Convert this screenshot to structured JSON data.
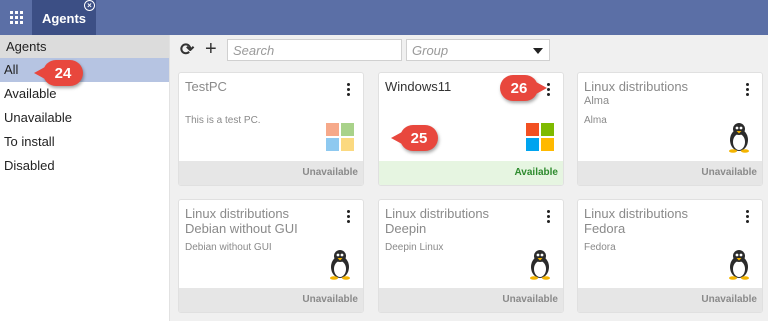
{
  "header": {
    "apps_icon": "grid-icon",
    "tab_label": "Agents",
    "tab_close_icon": "circle-x-icon"
  },
  "sidebar": {
    "title": "Agents",
    "items": [
      {
        "label": "All",
        "active": true
      },
      {
        "label": "Available"
      },
      {
        "label": "Unavailable"
      },
      {
        "label": "To install"
      },
      {
        "label": "Disabled"
      }
    ]
  },
  "toolbar": {
    "refresh_icon": "refresh-icon",
    "add_icon": "plus-icon",
    "search_placeholder": "Search",
    "group_placeholder": "Group"
  },
  "cards": [
    {
      "title": "TestPC",
      "subtitle": "",
      "description": "This is a test PC.",
      "status": "Unavailable",
      "os_icon": "windows-icon"
    },
    {
      "title": "Windows11",
      "subtitle": "",
      "description": "",
      "status": "Available",
      "os_icon": "windows-icon"
    },
    {
      "title": "Linux distributions",
      "subtitle": "Alma",
      "description": "Alma",
      "status": "Unavailable",
      "os_icon": "linux-icon"
    },
    {
      "title": "Linux distributions",
      "subtitle": "Debian without GUI",
      "description": "Debian without GUI",
      "status": "Unavailable",
      "os_icon": "linux-icon"
    },
    {
      "title": "Linux distributions",
      "subtitle": "Deepin",
      "description": "Deepin Linux",
      "status": "Unavailable",
      "os_icon": "linux-icon"
    },
    {
      "title": "Linux distributions",
      "subtitle": "Fedora",
      "description": "Fedora",
      "status": "Unavailable",
      "os_icon": "linux-icon"
    }
  ],
  "callouts": [
    "24",
    "25",
    "26"
  ],
  "colors": {
    "header_bg": "#5b6fa6",
    "active_tab_bg": "#3c4f85",
    "sidebar_active_bg": "#b6c4e2",
    "available_status": "#2e8b2e",
    "marker": "#e8473d"
  }
}
